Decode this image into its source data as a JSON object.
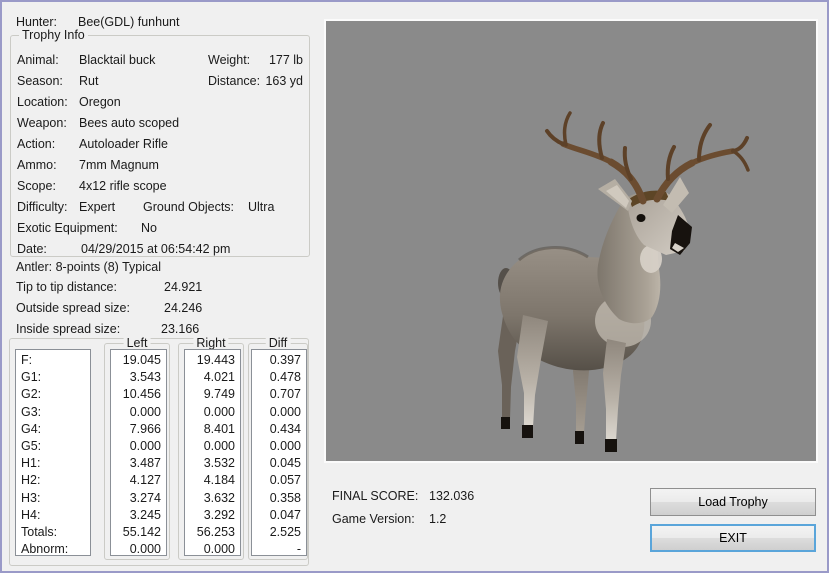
{
  "hunter": {
    "label": "Hunter:",
    "value": "Bee(GDL) funhunt"
  },
  "trophy_info": {
    "title": "Trophy Info",
    "rows": [
      {
        "label": "Animal:",
        "value": "Blacktail buck",
        "label2": "Weight:",
        "value2": "177 lb"
      },
      {
        "label": "Season:",
        "value": "Rut",
        "label2": "Distance:",
        "value2": "163 yd"
      },
      {
        "label": "Location:",
        "value": "Oregon"
      },
      {
        "label": "Weapon:",
        "value": "Bees auto scoped"
      },
      {
        "label": "Action:",
        "value": "Autoloader Rifle"
      },
      {
        "label": "Ammo:",
        "value": "7mm Magnum"
      },
      {
        "label": "Scope:",
        "value": "4x12 rifle scope"
      },
      {
        "label": "Difficulty:",
        "value": "Expert",
        "label2": "Ground Objects:",
        "value2": "Ultra"
      },
      {
        "label": "Exotic Equipment:",
        "value": "No"
      },
      {
        "label": "Date:",
        "value": "04/29/2015 at 06:54:42 pm"
      }
    ]
  },
  "antler": {
    "summary": "Antler: 8-points (8) Typical",
    "rows": [
      {
        "label": "Tip to tip distance:",
        "value": "24.921"
      },
      {
        "label": "Outside spread size:",
        "value": "24.246"
      },
      {
        "label": "Inside spread size:",
        "value": "23.166"
      }
    ]
  },
  "measurements": {
    "headers": {
      "left": "Left",
      "right": "Right",
      "diff": "Diff"
    },
    "rows": [
      {
        "name": "F:",
        "left": "19.045",
        "right": "19.443",
        "diff": "0.397"
      },
      {
        "name": "G1:",
        "left": "3.543",
        "right": "4.021",
        "diff": "0.478"
      },
      {
        "name": "G2:",
        "left": "10.456",
        "right": "9.749",
        "diff": "0.707"
      },
      {
        "name": "G3:",
        "left": "0.000",
        "right": "0.000",
        "diff": "0.000"
      },
      {
        "name": "G4:",
        "left": "7.966",
        "right": "8.401",
        "diff": "0.434"
      },
      {
        "name": "G5:",
        "left": "0.000",
        "right": "0.000",
        "diff": "0.000"
      },
      {
        "name": "H1:",
        "left": "3.487",
        "right": "3.532",
        "diff": "0.045"
      },
      {
        "name": "H2:",
        "left": "4.127",
        "right": "4.184",
        "diff": "0.057"
      },
      {
        "name": "H3:",
        "left": "3.274",
        "right": "3.632",
        "diff": "0.358"
      },
      {
        "name": "H4:",
        "left": "3.245",
        "right": "3.292",
        "diff": "0.047"
      },
      {
        "name": "Totals:",
        "left": "55.142",
        "right": "56.253",
        "diff": "2.525"
      },
      {
        "name": "Abnorm:",
        "left": "0.000",
        "right": "0.000",
        "diff": "-"
      }
    ]
  },
  "footer": {
    "final_score_label": "FINAL SCORE:",
    "final_score": "132.036",
    "version_label": "Game Version:",
    "version": "1.2"
  },
  "buttons": {
    "load": "Load Trophy",
    "exit": "EXIT"
  },
  "viewer": {
    "background": "#8a8a8a"
  },
  "colors": {
    "window_border": "#9a9ac8",
    "default_button_border": "#5aa5da",
    "groupbox_border": "#cbcbc6",
    "listbox_border": "#8b9097"
  }
}
